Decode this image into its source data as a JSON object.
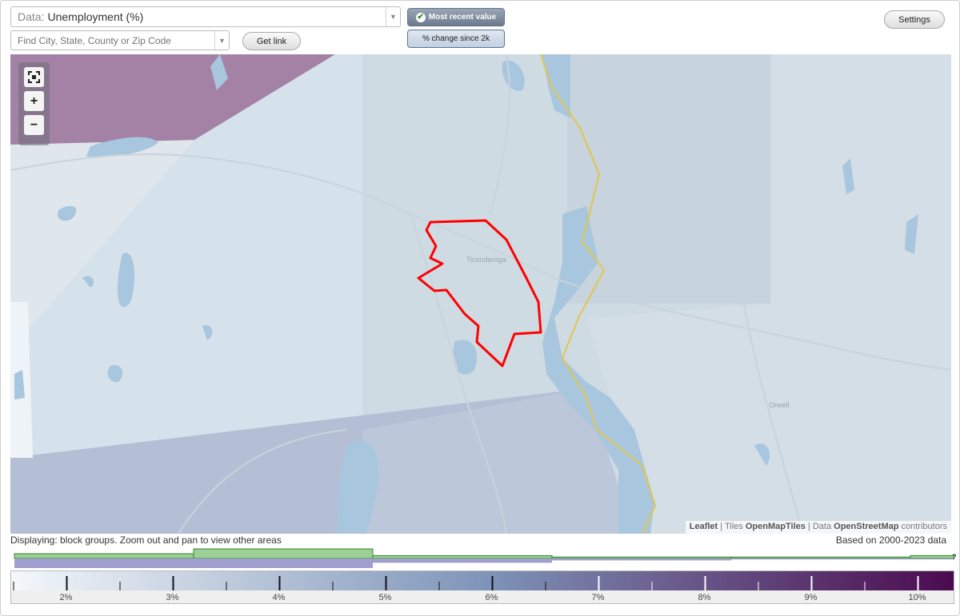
{
  "toolbar": {
    "data_label": "Data:",
    "data_value": "Unemployment (%)",
    "search_placeholder": "Find City, State, County or Zip Code",
    "get_link": "Get link",
    "mode_recent": "Most recent value",
    "mode_change": "% change since 2k",
    "settings": "Settings"
  },
  "map": {
    "place_labels": [
      "Ticonderoga",
      "Orwell"
    ],
    "selected_area_color": "#ff0000",
    "state_border_color": "#e0c64a",
    "attribution": {
      "leaflet": "Leaflet",
      "sep1": "|",
      "tiles_label": "Tiles",
      "tiles": "OpenMapTiles",
      "sep2": "|",
      "data_label": "Data",
      "osm": "OpenStreetMap",
      "contributors": "contributors"
    }
  },
  "footer": {
    "displaying": "Displaying: block groups. Zoom out and pan to view other areas",
    "based_on": "Based on 2000-2023 data",
    "unknown_marker": "?"
  },
  "legend": {
    "labels": [
      "2%",
      "3%",
      "4%",
      "5%",
      "6%",
      "7%",
      "8%",
      "9%",
      "10%"
    ],
    "color_low": "#f4f8fb",
    "color_mid": "#7f95b9",
    "color_high": "#4b0a4f"
  },
  "chart_data": {
    "type": "bar",
    "title": "",
    "series": [
      {
        "name": "",
        "color": "#9ecf96",
        "x": [
          1.5,
          3.2,
          4.9,
          6.6,
          8.3,
          10.0
        ],
        "values": [
          1,
          2,
          0.6,
          0.3,
          0.3,
          0.6
        ]
      },
      {
        "name": "",
        "color": "#a19fcf",
        "x": [
          1.5,
          3.2,
          4.9,
          6.6,
          8.3,
          10.0
        ],
        "values": [
          2,
          2,
          0.9,
          0.4,
          0.2,
          0.2
        ]
      }
    ],
    "xlim": [
      1.5,
      10.4
    ],
    "legend_ticks": [
      2,
      3,
      4,
      5,
      6,
      7,
      8,
      9,
      10
    ]
  }
}
